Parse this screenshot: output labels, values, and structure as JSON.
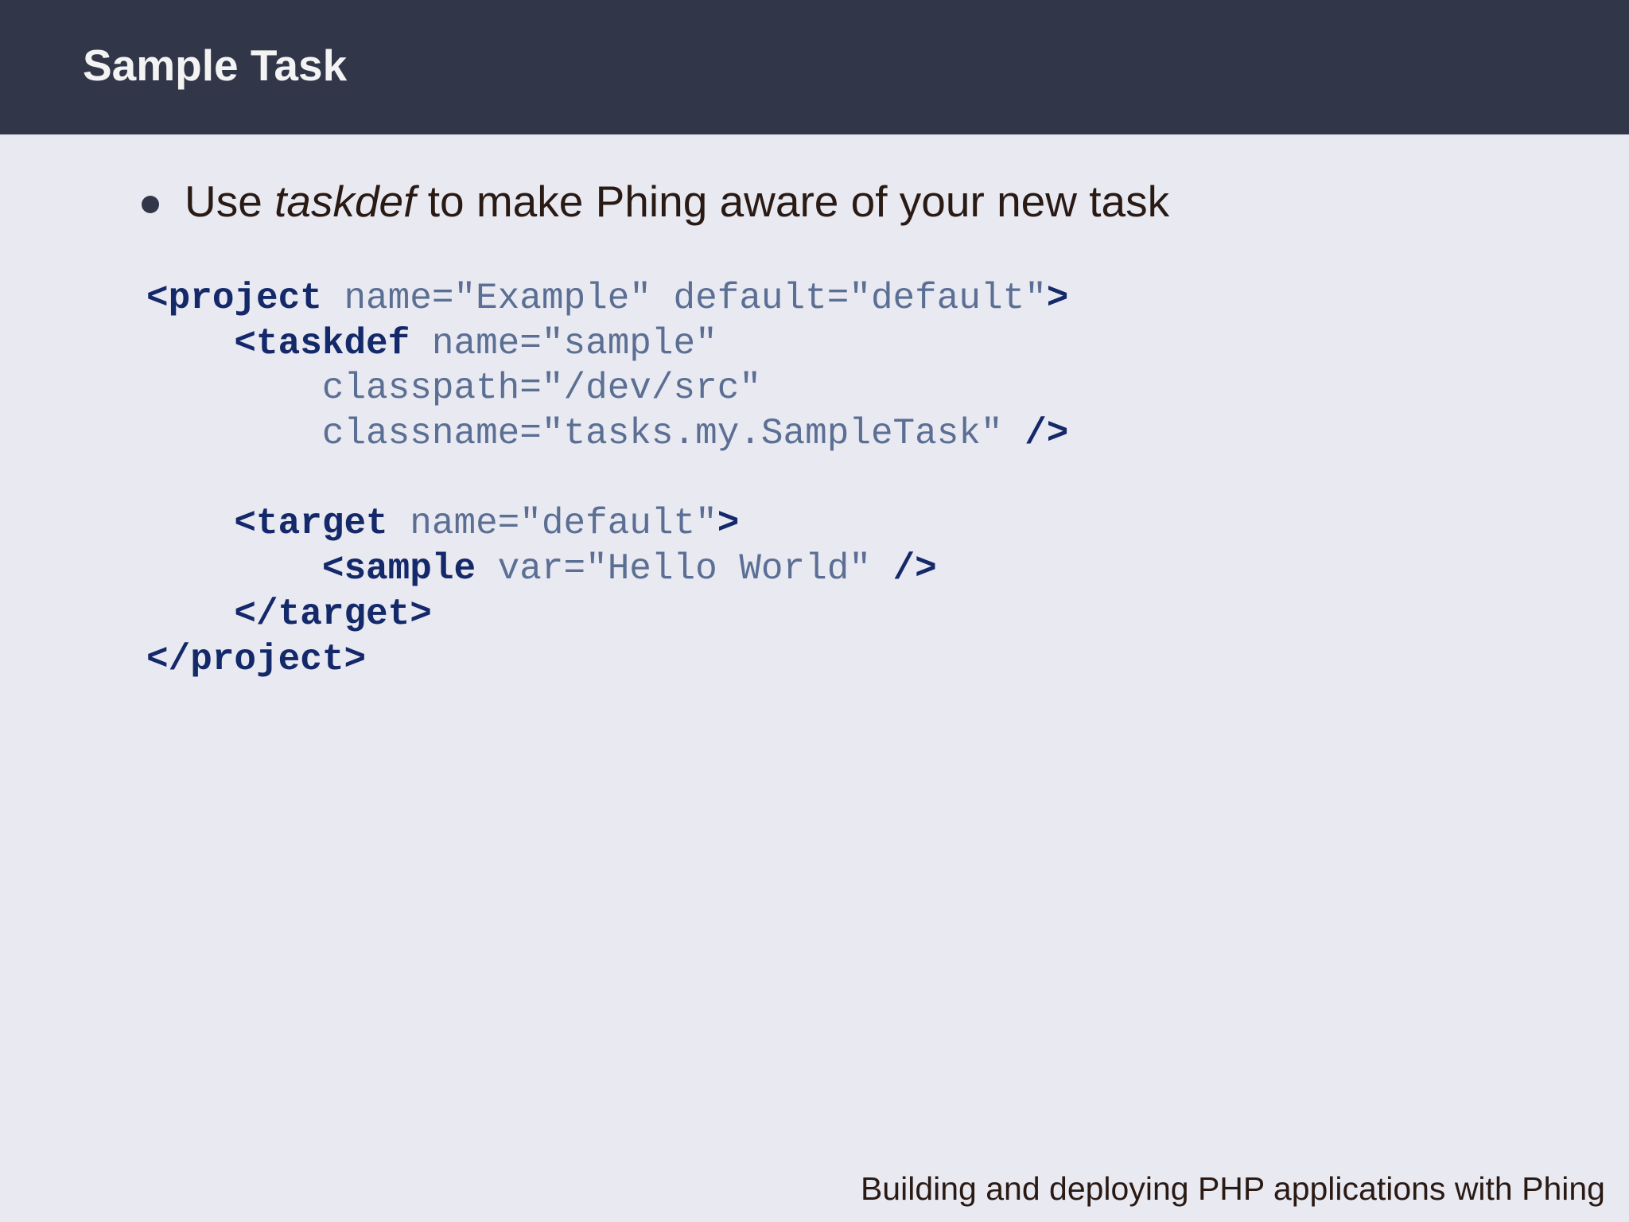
{
  "slide": {
    "title": "Sample Task",
    "bullet": {
      "before": "Use ",
      "emphasis": "taskdef",
      "after": " to make Phing aware of your new task"
    },
    "code_lines": [
      [
        {
          "t": "tag",
          "v": "<project"
        },
        {
          "t": "attr",
          "v": " name=\"Example\" default=\"default\""
        },
        {
          "t": "tag",
          "v": ">"
        }
      ],
      [
        {
          "t": "tag",
          "v": "    <taskdef"
        },
        {
          "t": "attr",
          "v": " name=\"sample\""
        }
      ],
      [
        {
          "t": "attr",
          "v": "        classpath=\"/dev/src\""
        }
      ],
      [
        {
          "t": "attr",
          "v": "        classname=\"tasks.my.SampleTask\" "
        },
        {
          "t": "tag",
          "v": "/>"
        }
      ],
      [],
      [
        {
          "t": "tag",
          "v": "    <target"
        },
        {
          "t": "attr",
          "v": " name=\"default\""
        },
        {
          "t": "tag",
          "v": ">"
        }
      ],
      [
        {
          "t": "tag",
          "v": "        <sample"
        },
        {
          "t": "attr",
          "v": " var=\"Hello World\" "
        },
        {
          "t": "tag",
          "v": "/>"
        }
      ],
      [
        {
          "t": "tag",
          "v": "    </target>"
        }
      ],
      [
        {
          "t": "tag",
          "v": "</project>"
        }
      ]
    ],
    "footer": "Building and deploying PHP applications with Phing"
  },
  "colors": {
    "header_bg": "#313649",
    "slide_bg": "#e9e9f1",
    "code_tag": "#14296a",
    "code_attr": "#5b6f94",
    "body_text": "#2a1a14"
  }
}
